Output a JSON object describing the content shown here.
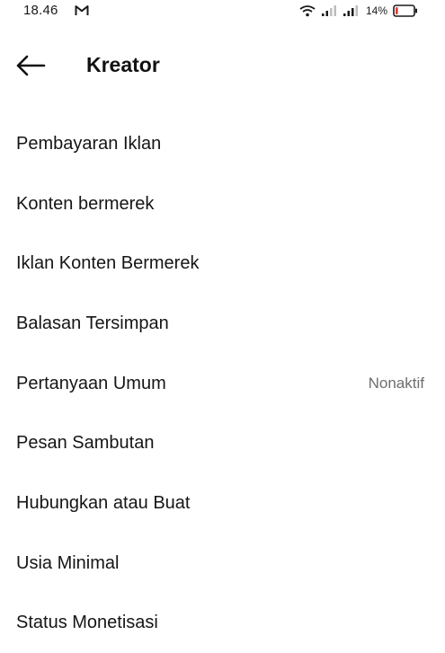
{
  "status_bar": {
    "time": "18.46",
    "battery_percent": "14%",
    "battery_level": 0.14,
    "battery_low_color": "#e53935",
    "icons": [
      "gmail-icon",
      "wifi-icon",
      "signal-icon",
      "signal-icon",
      "battery-icon"
    ]
  },
  "header": {
    "title": "Kreator",
    "back_icon": "arrow-left-icon"
  },
  "menu": {
    "items": [
      {
        "label": "Pembayaran Iklan",
        "value": ""
      },
      {
        "label": "Konten bermerek",
        "value": ""
      },
      {
        "label": "Iklan Konten Bermerek",
        "value": ""
      },
      {
        "label": "Balasan Tersimpan",
        "value": ""
      },
      {
        "label": "Pertanyaan Umum",
        "value": "Nonaktif"
      },
      {
        "label": "Pesan Sambutan",
        "value": ""
      },
      {
        "label": "Hubungkan atau Buat",
        "value": ""
      },
      {
        "label": "Usia Minimal",
        "value": ""
      },
      {
        "label": "Status Monetisasi",
        "value": ""
      }
    ]
  }
}
